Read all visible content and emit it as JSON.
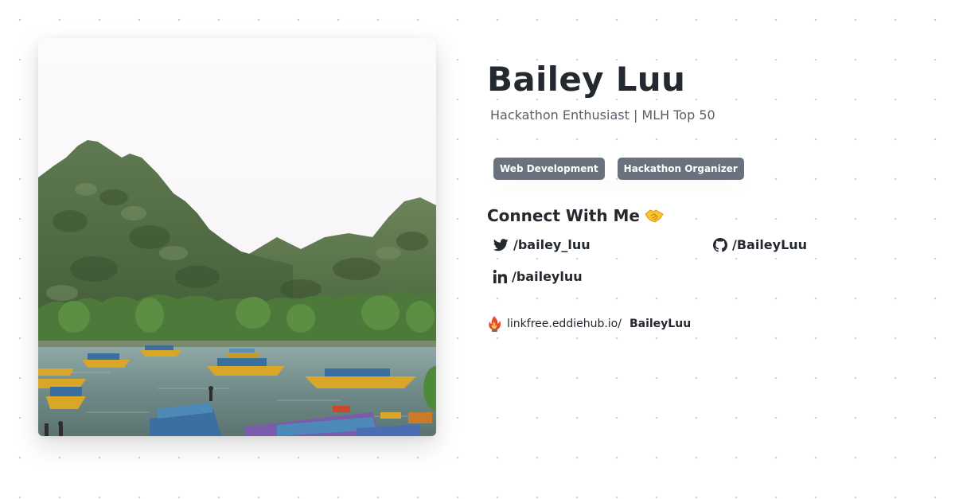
{
  "profile": {
    "name": "Bailey Luu",
    "tagline": "Hackathon Enthusiast | MLH Top 50",
    "tags": [
      "Web Development",
      "Hackathon Organizer"
    ],
    "connect_title": "Connect With Me",
    "connect_emoji": "handshake-icon"
  },
  "photo": {
    "description_icon": "landscape-photo",
    "alt": "Bailey Luu"
  },
  "socials": {
    "twitter": {
      "icon": "twitter-icon",
      "label": "/bailey_luu"
    },
    "github": {
      "icon": "github-icon",
      "label": "/BaileyLuu"
    },
    "linkedin": {
      "icon": "linkedin-icon",
      "label": "/baileyluu"
    }
  },
  "linkfree": {
    "icon": "linkfree-logo-icon",
    "base": "linkfree.eddiehub.io/",
    "username": "BaileyLuu"
  },
  "colors": {
    "text": "#24292f",
    "muted": "#57606a",
    "tag_bg": "#6a737d",
    "tag_text": "#ffffff",
    "dot_grid": "#c9c9c9"
  }
}
